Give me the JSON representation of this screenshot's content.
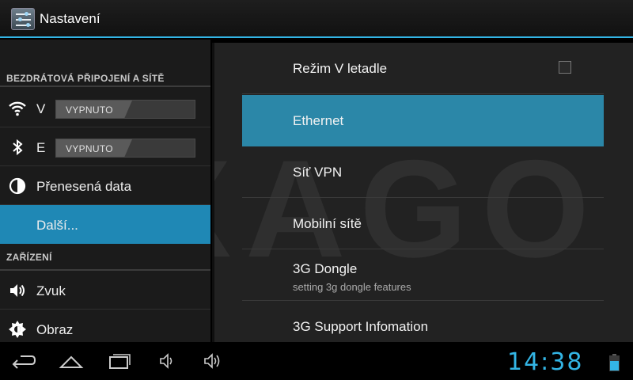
{
  "app": {
    "title": "Nastavení",
    "icon": "settings-sliders-icon"
  },
  "left_pane": {
    "section_wireless": "BEZDRÁTOVÁ PŘIPOJENÍ A SÍTĚ",
    "wifi": {
      "label": "V",
      "icon": "wifi-icon",
      "toggle": "VYPNUTO"
    },
    "bluetooth": {
      "label": "E",
      "icon": "bluetooth-icon",
      "toggle": "VYPNUTO"
    },
    "data_usage": {
      "label": "Přenesená data",
      "icon": "data-usage-icon"
    },
    "more": {
      "label": "Další...",
      "selected": true
    },
    "section_device": "ZAŘÍZENÍ",
    "sound": {
      "label": "Zvuk",
      "icon": "speaker-icon"
    },
    "display": {
      "label": "Obraz",
      "icon": "brightness-icon"
    }
  },
  "right_pane": {
    "watermark": "AXAGO",
    "items": [
      {
        "label": "Režim V letadle",
        "checkbox": false
      },
      {
        "label": "Ethernet",
        "selected": true
      },
      {
        "label": "Síť VPN"
      },
      {
        "label": "Mobilní sítě"
      },
      {
        "label": "3G Dongle",
        "summary": "setting 3g dongle features"
      },
      {
        "label": "3G Support Infomation"
      }
    ]
  },
  "navbar": {
    "back": "back-icon",
    "home": "home-icon",
    "recents": "recent-apps-icon",
    "volume_down": "volume-down-icon",
    "volume_up": "volume-up-icon",
    "clock": "14:38",
    "battery": "battery-icon",
    "accent": "#33b5e5"
  }
}
